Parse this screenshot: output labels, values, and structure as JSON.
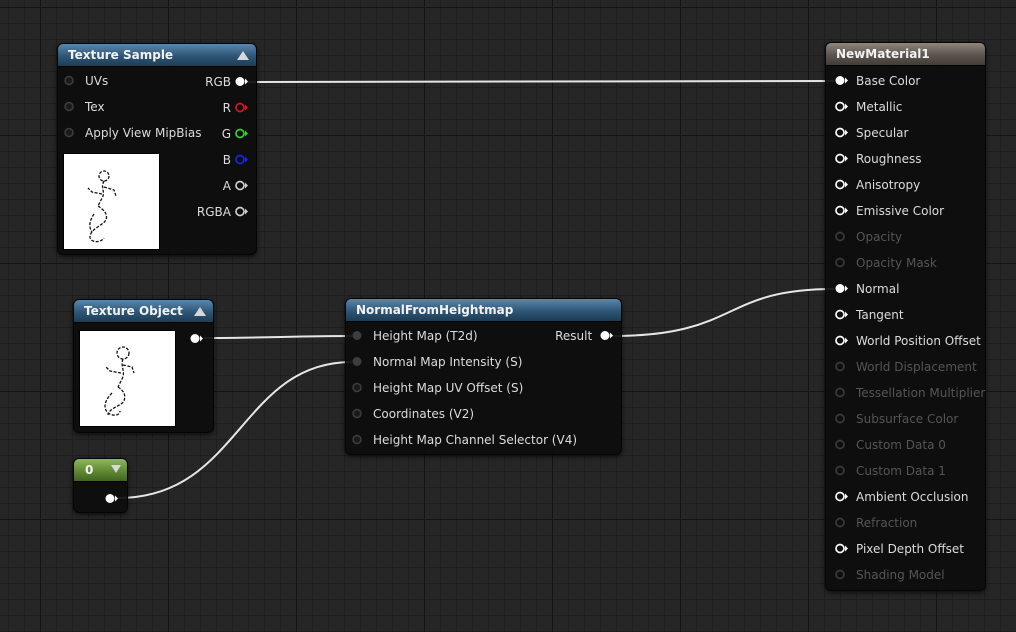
{
  "colors": {
    "node_blue": "#2e5676",
    "node_brown": "#5c554e",
    "const_green": "#5f8a33",
    "pin_red": "#e0141f",
    "pin_green": "#33d42a",
    "pin_blue": "#1626e8",
    "wire": "#e6e6e6"
  },
  "texture_sample": {
    "title": "Texture Sample",
    "inputs": [
      {
        "label": "UVs"
      },
      {
        "label": "Tex"
      },
      {
        "label": "Apply View MipBias"
      }
    ],
    "outputs": [
      {
        "label": "RGB",
        "color": "#ffffff",
        "connected": true
      },
      {
        "label": "R",
        "color": "#e0141f",
        "connected": false
      },
      {
        "label": "G",
        "color": "#33d42a",
        "connected": false
      },
      {
        "label": "B",
        "color": "#1626e8",
        "connected": false
      },
      {
        "label": "A",
        "color": "#cfcfcf",
        "connected": false
      },
      {
        "label": "RGBA",
        "color": "#cfcfcf",
        "connected": false
      }
    ],
    "preview_icon": "stick-figure-texture"
  },
  "texture_object": {
    "title": "Texture Object",
    "preview_icon": "stick-figure-texture"
  },
  "constant": {
    "value": "0"
  },
  "normal_from_heightmap": {
    "title": "NormalFromHeightmap",
    "inputs": [
      {
        "label": "Height Map (T2d)"
      },
      {
        "label": "Normal Map Intensity (S)"
      },
      {
        "label": "Height Map UV Offset (S)"
      },
      {
        "label": "Coordinates (V2)"
      },
      {
        "label": "Height Map Channel Selector (V4)"
      }
    ],
    "output": "Result"
  },
  "material": {
    "title": "NewMaterial1",
    "inputs": [
      {
        "label": "Base Color",
        "enabled": true,
        "connected": true
      },
      {
        "label": "Metallic",
        "enabled": true,
        "connected": false
      },
      {
        "label": "Specular",
        "enabled": true,
        "connected": false
      },
      {
        "label": "Roughness",
        "enabled": true,
        "connected": false
      },
      {
        "label": "Anisotropy",
        "enabled": true,
        "connected": false
      },
      {
        "label": "Emissive Color",
        "enabled": true,
        "connected": false
      },
      {
        "label": "Opacity",
        "enabled": false,
        "connected": false
      },
      {
        "label": "Opacity Mask",
        "enabled": false,
        "connected": false
      },
      {
        "label": "Normal",
        "enabled": true,
        "connected": true
      },
      {
        "label": "Tangent",
        "enabled": true,
        "connected": false
      },
      {
        "label": "World Position Offset",
        "enabled": true,
        "connected": false
      },
      {
        "label": "World Displacement",
        "enabled": false,
        "connected": false
      },
      {
        "label": "Tessellation Multiplier",
        "enabled": false,
        "connected": false
      },
      {
        "label": "Subsurface Color",
        "enabled": false,
        "connected": false
      },
      {
        "label": "Custom Data 0",
        "enabled": false,
        "connected": false
      },
      {
        "label": "Custom Data 1",
        "enabled": false,
        "connected": false
      },
      {
        "label": "Ambient Occlusion",
        "enabled": true,
        "connected": false
      },
      {
        "label": "Refraction",
        "enabled": false,
        "connected": false
      },
      {
        "label": "Pixel Depth Offset",
        "enabled": true,
        "connected": false
      },
      {
        "label": "Shading Model",
        "enabled": false,
        "connected": false
      }
    ]
  }
}
